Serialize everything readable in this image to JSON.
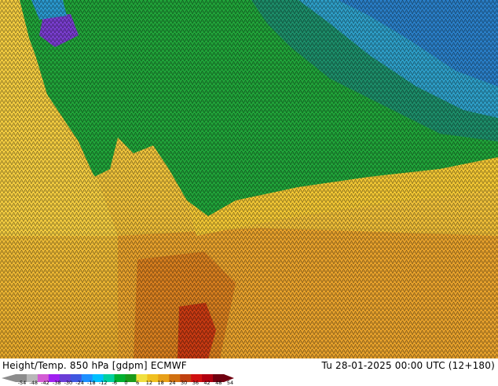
{
  "map": {
    "title": "Height/Temp. 850 hPa [gdpm] ECMWF",
    "valid_time": "Tu 28-01-2025 00:00 UTC (12+180)",
    "colorbar": {
      "ticks": [
        "-54",
        "-48",
        "-42",
        "-38",
        "-30",
        "-24",
        "-18",
        "-12",
        "-6",
        "0",
        "6",
        "12",
        "18",
        "24",
        "30",
        "36",
        "42",
        "48",
        "54"
      ],
      "colors": [
        "#8c8c8c",
        "#b8b8b8",
        "#d35cd3",
        "#a020f0",
        "#6a3dd6",
        "#3f57e0",
        "#1e90ff",
        "#00c0ff",
        "#00d0a0",
        "#00b030",
        "#1a9a1a",
        "#f0e040",
        "#f0c020",
        "#e8a018",
        "#d07010",
        "#c04010",
        "#d01010",
        "#b00010",
        "#700010"
      ]
    },
    "icons": [
      "triangle-left-arrow-icon",
      "triangle-right-arrow-icon"
    ]
  }
}
